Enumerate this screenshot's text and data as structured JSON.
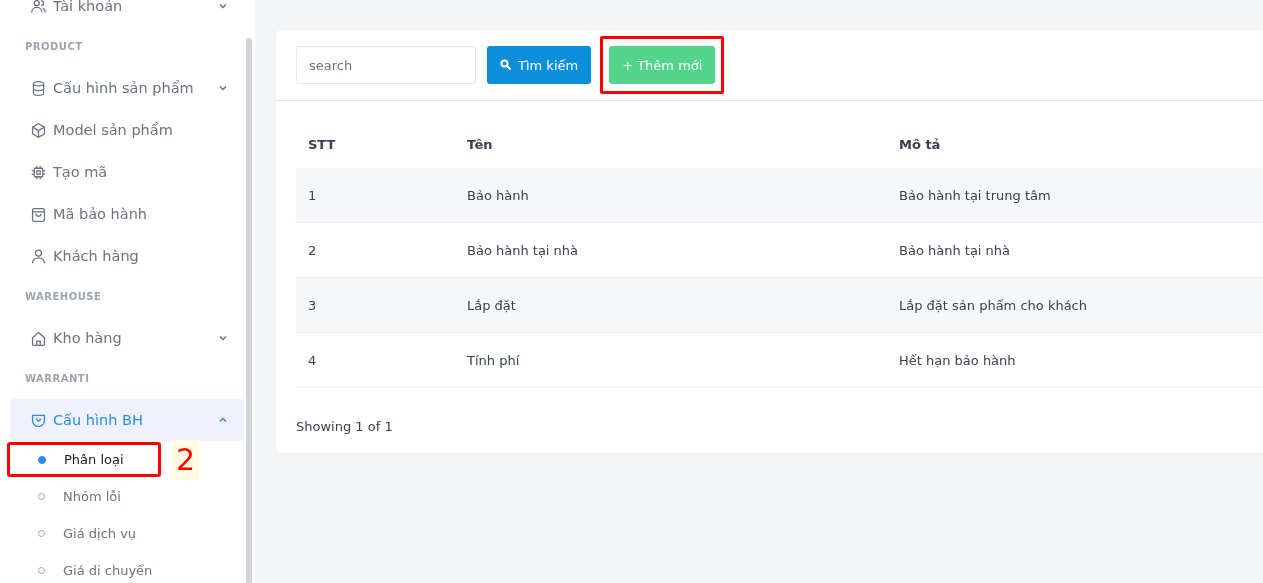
{
  "sidebar": {
    "sections": [
      {
        "items": [
          {
            "label": "Tài khoản",
            "expandable": true,
            "expanded": false,
            "selected": false
          }
        ]
      },
      {
        "heading": "PRODUCT",
        "items": [
          {
            "label": "Cấu hình sản phẩm",
            "expandable": true,
            "expanded": false,
            "selected": false
          },
          {
            "label": "Model sản phẩm",
            "expandable": false,
            "selected": false
          },
          {
            "label": "Tạo mã",
            "expandable": false,
            "selected": false
          },
          {
            "label": "Mã bảo hành",
            "expandable": false,
            "selected": false
          },
          {
            "label": "Khách hàng",
            "expandable": false,
            "selected": false
          }
        ]
      },
      {
        "heading": "WAREHOUSE",
        "items": [
          {
            "label": "Kho hàng",
            "expandable": true,
            "expanded": false,
            "selected": false
          }
        ]
      },
      {
        "heading": "WARRANTI",
        "items": [
          {
            "label": "Cấu hình BH",
            "expandable": true,
            "expanded": true,
            "selected": true,
            "children": [
              {
                "label": "Phân loại",
                "selected": true,
                "highlighted": true,
                "step_label": "2"
              },
              {
                "label": "Nhóm lỗi",
                "selected": false,
                "highlighted": false
              },
              {
                "label": "Giá dịch vụ",
                "selected": false,
                "highlighted": false
              },
              {
                "label": "Giá di chuyển",
                "selected": false,
                "highlighted": false
              }
            ]
          }
        ]
      }
    ]
  },
  "toolbar": {
    "search": {
      "placeholder": "search"
    },
    "search_button": {
      "label": "Tìm kiếm"
    },
    "add_button": {
      "label": "+ Thêm mới",
      "highlighted": true
    }
  },
  "table": {
    "columns": [
      "STT",
      "Tên",
      "Mô tả"
    ],
    "rows": [
      [
        "1",
        "Bảo hành",
        "Bảo hành tại trung tâm"
      ],
      [
        "2",
        "Bảo hành tại nhà",
        "Bảo hành tại nhà"
      ],
      [
        "3",
        "Lắp đặt",
        "Lắp đặt sản phẩm cho khách"
      ],
      [
        "4",
        "Tính phí",
        "Hết hạn bảo hành"
      ]
    ]
  },
  "footer": "Showing 1 of 1"
}
